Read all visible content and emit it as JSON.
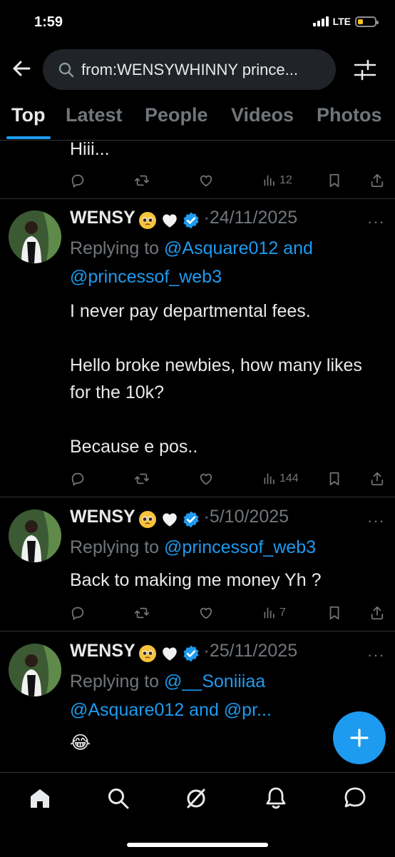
{
  "status_bar": {
    "time": "1:59",
    "network": "LTE"
  },
  "search": {
    "query": "from:WENSYWHINNY prince..."
  },
  "tabs": [
    {
      "label": "Top",
      "active": true
    },
    {
      "label": "Latest"
    },
    {
      "label": "People"
    },
    {
      "label": "Videos"
    },
    {
      "label": "Photos"
    }
  ],
  "partial_tweet": {
    "text": "Hiii...",
    "views": "12"
  },
  "tweets": [
    {
      "name": "WENSY",
      "date": "24/11/2025",
      "replying_prefix": "Replying to",
      "replying_line1": "@Asquare012 and",
      "replying_line2": "@princessof_web3",
      "text": "I never pay departmental fees.\n\nHello broke newbies, how many likes for the 10k?\n\nBecause e pos..",
      "views": "144"
    },
    {
      "name": "WENSY",
      "date": "5/10/2025",
      "replying_prefix": "Replying to",
      "replying_line1": "@princessof_web3",
      "text": "Back to making me money Yh ?",
      "views": "7"
    },
    {
      "name": "WENSY",
      "date": "25/11/2025",
      "replying_prefix": "Replying to",
      "replying_line1": "@__Soniiiaa",
      "replying_line2": "@Asquare012 and @pr...",
      "text": "😂"
    }
  ],
  "separator": "·",
  "more_label": "···",
  "colors": {
    "accent": "#1d9bf0",
    "background": "#000000",
    "muted": "#71767b"
  }
}
